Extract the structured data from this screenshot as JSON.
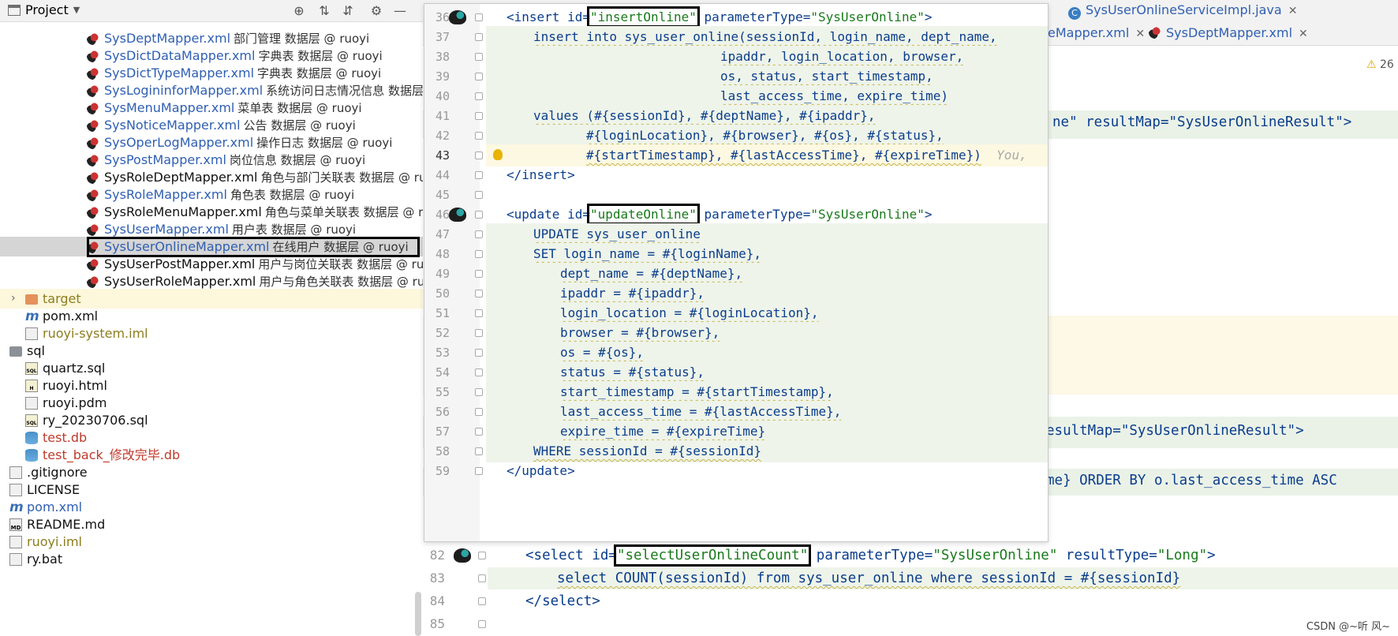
{
  "project_panel": {
    "title": "Project",
    "tree": [
      {
        "name": "SysDeptMapper.xml",
        "desc": "部门管理 数据层 @ ruoyi",
        "color": "blue",
        "icon": "mybatis-bird-icon",
        "indent": 110
      },
      {
        "name": "SysDictDataMapper.xml",
        "desc": "字典表 数据层 @ ruoyi",
        "color": "blue",
        "icon": "mybatis-bird-icon",
        "indent": 110
      },
      {
        "name": "SysDictTypeMapper.xml",
        "desc": "字典表 数据层 @ ruoyi",
        "color": "blue",
        "icon": "mybatis-bird-icon",
        "indent": 110
      },
      {
        "name": "SysLogininforMapper.xml",
        "desc": "系统访问日志情况信息 数据层",
        "color": "blue",
        "icon": "mybatis-bird-icon",
        "indent": 110
      },
      {
        "name": "SysMenuMapper.xml",
        "desc": "菜单表 数据层 @ ruoyi",
        "color": "blue",
        "icon": "mybatis-bird-icon",
        "indent": 110
      },
      {
        "name": "SysNoticeMapper.xml",
        "desc": "公告 数据层 @ ruoyi",
        "color": "blue",
        "icon": "mybatis-bird-icon",
        "indent": 110
      },
      {
        "name": "SysOperLogMapper.xml",
        "desc": "操作日志 数据层 @ ruoyi",
        "color": "blue",
        "icon": "mybatis-bird-icon",
        "indent": 110
      },
      {
        "name": "SysPostMapper.xml",
        "desc": "岗位信息 数据层 @ ruoyi",
        "color": "blue",
        "icon": "mybatis-bird-icon",
        "indent": 110
      },
      {
        "name": "SysRoleDeptMapper.xml",
        "desc": "角色与部门关联表 数据层 @ ru",
        "color": "black",
        "icon": "mybatis-bird-icon",
        "indent": 110
      },
      {
        "name": "SysRoleMapper.xml",
        "desc": "角色表 数据层 @ ruoyi",
        "color": "blue",
        "icon": "mybatis-bird-icon",
        "indent": 110
      },
      {
        "name": "SysRoleMenuMapper.xml",
        "desc": "角色与菜单关联表 数据层 @ r",
        "color": "black",
        "icon": "mybatis-bird-icon",
        "indent": 110
      },
      {
        "name": "SysUserMapper.xml",
        "desc": "用户表 数据层 @ ruoyi",
        "color": "blue",
        "icon": "mybatis-bird-icon",
        "indent": 110
      },
      {
        "name": "SysUserOnlineMapper.xml",
        "desc": "在线用户 数据层 @ ruoyi",
        "color": "blue",
        "icon": "mybatis-bird-icon",
        "indent": 110,
        "selected": true
      },
      {
        "name": "SysUserPostMapper.xml",
        "desc": "用户与岗位关联表 数据层 @ ru",
        "color": "black",
        "icon": "mybatis-bird-icon",
        "indent": 110
      },
      {
        "name": "SysUserRoleMapper.xml",
        "desc": "用户与角色关联表 数据层 @ ru",
        "color": "black",
        "icon": "mybatis-bird-icon",
        "indent": 110
      },
      {
        "name": "target",
        "desc": "",
        "color": "olive",
        "icon": "folder-icon",
        "indent": 32,
        "chevron": true,
        "highlight": true
      },
      {
        "name": "pom.xml",
        "desc": "",
        "color": "black",
        "icon": "maven-icon",
        "indent": 32
      },
      {
        "name": "ruoyi-system.iml",
        "desc": "",
        "color": "olive",
        "icon": "module-file-icon",
        "indent": 32
      },
      {
        "name": "sql",
        "desc": "",
        "color": "black",
        "icon": "folder-icon",
        "indent": 12,
        "gray": true
      },
      {
        "name": "quartz.sql",
        "desc": "",
        "color": "black",
        "icon": "sql-file-icon",
        "indent": 32
      },
      {
        "name": "ruoyi.html",
        "desc": "",
        "color": "black",
        "icon": "html-file-icon",
        "indent": 32
      },
      {
        "name": "ruoyi.pdm",
        "desc": "",
        "color": "black",
        "icon": "file-icon",
        "indent": 32
      },
      {
        "name": "ry_20230706.sql",
        "desc": "",
        "color": "black",
        "icon": "sql-file-icon",
        "indent": 32
      },
      {
        "name": "test.db",
        "desc": "",
        "color": "red",
        "icon": "database-icon",
        "indent": 32
      },
      {
        "name": "test_back_修改完毕.db",
        "desc": "",
        "color": "red",
        "icon": "database-icon",
        "indent": 32
      },
      {
        "name": ".gitignore",
        "desc": "",
        "color": "black",
        "icon": "gitignore-icon",
        "indent": 12
      },
      {
        "name": "LICENSE",
        "desc": "",
        "color": "black",
        "icon": "file-icon",
        "indent": 12
      },
      {
        "name": "pom.xml",
        "desc": "",
        "color": "blue",
        "icon": "maven-icon",
        "indent": 12
      },
      {
        "name": "README.md",
        "desc": "",
        "color": "black",
        "icon": "markdown-icon",
        "indent": 12
      },
      {
        "name": "ruoyi.iml",
        "desc": "",
        "color": "olive",
        "icon": "module-file-icon",
        "indent": 12
      },
      {
        "name": "ry.bat",
        "desc": "",
        "color": "black",
        "icon": "file-icon",
        "indent": 12
      }
    ]
  },
  "tabs": {
    "row1": [
      {
        "label": "SysUserOnlineServiceImpl.java",
        "icon": "java-class-icon"
      }
    ],
    "row2": [
      {
        "label": "eMapper.xml"
      },
      {
        "label": "SysDeptMapper.xml",
        "icon": "mybatis-bird-icon"
      }
    ],
    "warnings": "26"
  },
  "background_code": {
    "line1": "ne\" resultMap=\"SysUserOnlineResult\">",
    "line2": "esultMap=\"SysUserOnlineResult\">",
    "line3": "me} ORDER BY o.last_access_time ASC"
  },
  "popup": {
    "lines": [
      {
        "n": "36",
        "html": "<span class='tag'>&lt;insert</span> <span class='attr'>id=</span><span class='val boxed'>\"insertOnline\"</span> <span class='attr'>parameterType=</span><span class='val'>\"SysUserOnline\"</span><span class='tag'>&gt;</span>",
        "indent": 104,
        "mybatis": true
      },
      {
        "n": "37",
        "html": "<span class='sql squig'>insert into sys_user_online(sessionId, login_name, dept_name,</span>",
        "indent": 138,
        "shade": true
      },
      {
        "n": "38",
        "html": "<span class='sql squig'>ipaddr, login_location, browser,</span>",
        "indent": 375,
        "shade": true
      },
      {
        "n": "39",
        "html": "<span class='sql squig'>os, status, start_timestamp,</span>",
        "indent": 375,
        "shade": true
      },
      {
        "n": "40",
        "html": "<span class='sql squig'>last_access_time, expire_time)</span>",
        "indent": 375,
        "shade": true
      },
      {
        "n": "41",
        "html": "<span class='sql squig'>values (#{sessionId}, #{deptName}, #{ipaddr},</span>",
        "indent": 138,
        "shade": true
      },
      {
        "n": "42",
        "html": "<span class='sql squig'>#{loginLocation}, #{browser}, #{os}, #{status},</span>",
        "indent": 205,
        "shade": true
      },
      {
        "n": "43",
        "html": "<span class='sql squig'>#{startTimestamp}, #{lastAccessTime}, #{expireTime})</span>  <span class='hint'>You,</span>",
        "indent": 205,
        "shade": true,
        "current": true,
        "bulb": true
      },
      {
        "n": "44",
        "html": "<span class='tag'>&lt;/insert&gt;</span>",
        "indent": 104
      },
      {
        "n": "45",
        "html": "",
        "indent": 104
      },
      {
        "n": "46",
        "html": "<span class='tag'>&lt;update</span> <span class='attr'>id=</span><span class='val boxed'>\"updateOnline\"</span> <span class='attr'>parameterType=</span><span class='val'>\"SysUserOnline\"</span><span class='tag'>&gt;</span>",
        "indent": 104,
        "mybatis": true
      },
      {
        "n": "47",
        "html": "<span class='sql squig'>UPDATE sys_user_online</span>",
        "indent": 138,
        "shade": true
      },
      {
        "n": "48",
        "html": "<span class='sql squig'>SET login_name = #{loginName},</span>",
        "indent": 138,
        "shade": true
      },
      {
        "n": "49",
        "html": "<span class='sql squig'>dept_name = #{deptName},</span>",
        "indent": 172,
        "shade": true
      },
      {
        "n": "50",
        "html": "<span class='sql squig'>ipaddr = #{ipaddr},</span>",
        "indent": 172,
        "shade": true
      },
      {
        "n": "51",
        "html": "<span class='sql squig'>login_location = #{loginLocation},</span>",
        "indent": 172,
        "shade": true
      },
      {
        "n": "52",
        "html": "<span class='sql squig'>browser = #{browser},</span>",
        "indent": 172,
        "shade": true
      },
      {
        "n": "53",
        "html": "<span class='sql squig'>os = #{os},</span>",
        "indent": 172,
        "shade": true
      },
      {
        "n": "54",
        "html": "<span class='sql squig'>status = #{status},</span>",
        "indent": 172,
        "shade": true
      },
      {
        "n": "55",
        "html": "<span class='sql squig'>start_timestamp = #{startTimestamp},</span>",
        "indent": 172,
        "shade": true
      },
      {
        "n": "56",
        "html": "<span class='sql squig'>last_access_time = #{lastAccessTime},</span>",
        "indent": 172,
        "shade": true
      },
      {
        "n": "57",
        "html": "<span class='sql squig'>expire_time = #{expireTime}</span>",
        "indent": 172,
        "shade": true
      },
      {
        "n": "58",
        "html": "<span class='sql squig'>WHERE sessionId = #{sessionId}</span>",
        "indent": 138,
        "shade": true
      },
      {
        "n": "59",
        "html": "<span class='tag'>&lt;/update&gt;</span>",
        "indent": 104
      }
    ]
  },
  "lower_code": {
    "lines": [
      {
        "n": "82",
        "html": "<span class='tag'>&lt;select</span> <span class='attr'>id=</span><span class='val boxed'>\"selectUserOnlineCount\"</span> <span class='attr'>parameterType=</span><span class='val'>\"SysUserOnline\"</span> <span class='attr'>resultType=</span><span class='val'>\"Long\"</span><span class='tag'>&gt;</span>",
        "indent": 130,
        "mybatis": true
      },
      {
        "n": "83",
        "html": "<span class='sql squig'>select COUNT(sessionId) from sys_user_online where sessionId = #{sessionId}</span>",
        "indent": 170,
        "shade": true
      },
      {
        "n": "84",
        "html": "<span class='tag'>&lt;/select&gt;</span>",
        "indent": 130
      },
      {
        "n": "85",
        "html": "",
        "indent": 130
      }
    ]
  },
  "watermark": "CSDN @~听 风~"
}
